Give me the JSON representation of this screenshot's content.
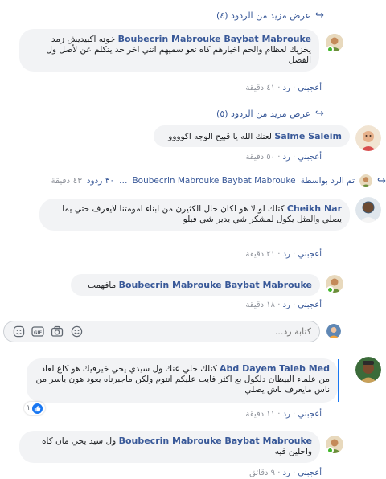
{
  "view_more_1": "عرض مزيد من الردود (٤)",
  "view_more_2": "عرض مزيد من الردود (٥)",
  "thread_reply": {
    "prefix": "تم الرد بواسطة",
    "names": "Boubecrin Mabrouke Baybat Mabrouke",
    "middle": " … ",
    "count": "٣٠ ردود",
    "time": "٤٣ دقيقة"
  },
  "comments": [
    {
      "author": "Boubecrin Mabrouke Baybat Mabrouke",
      "text": "خوته اكبيديش زمد يخزيك لعظام والحم اخبارهم كاه تعو سميهم انتي اخر حد يتكلم عن لأصل ول الفصل",
      "like": "أعجبني",
      "reply": "رد",
      "time": "٤١ دقيقة"
    },
    {
      "author": "Salme Saleim",
      "text": "لعنك الله يا قبيح الوجه اكوووو",
      "like": "أعجبني",
      "reply": "رد",
      "time": "٥٠ دقيقة"
    },
    {
      "author": "Cheikh Nar",
      "text": "كتلك لو لا هو لكان حال الكثيرن من ابناء امومتنا لايعرف حتي يما يصلي والمثل يكول لمشكر شي يدير شي فيلو",
      "like": "أعجبني",
      "reply": "رد",
      "time": "٢١ دقيقة"
    },
    {
      "author": "Boubecrin Mabrouke Baybat Mabrouke",
      "text": "مافهمت",
      "like": "أعجبني",
      "reply": "رد",
      "time": "١٨ دقيقة"
    },
    {
      "author": "Abd Dayem Taleb Med",
      "text": "كتلك خلي عنك ول سيدي يحي خيرفيك هو كاع لعاد من علماء البيظان دلكول بع اكثر فايت عليكم انتوم ولكن ماجبرناه يعود هون ياسر من ناس مايعرف باش يصلي",
      "like": "أعجبني",
      "reply": "رد",
      "time": "١١ دقيقة",
      "reactions": "١"
    },
    {
      "author": "Boubecrin Mabrouke Baybat Mabrouke",
      "text": "ول سيد يحي مان كاه واحلين فيه",
      "like": "أعجبني",
      "reply": "رد",
      "time": "٩ دقائق"
    }
  ],
  "composer": {
    "placeholder": "كتابة رد..."
  },
  "icons": {
    "reply_arrow": "reply-arrow-icon",
    "emoji": "emoji-icon",
    "camera": "camera-icon",
    "gif": "gif-icon",
    "sticker": "sticker-icon",
    "like": "thumbs-up-icon"
  },
  "colors": {
    "link": "#385898",
    "bubble": "#f2f3f5",
    "meta": "#90949c",
    "like_blue": "#1877f2",
    "online": "#42b72a"
  }
}
